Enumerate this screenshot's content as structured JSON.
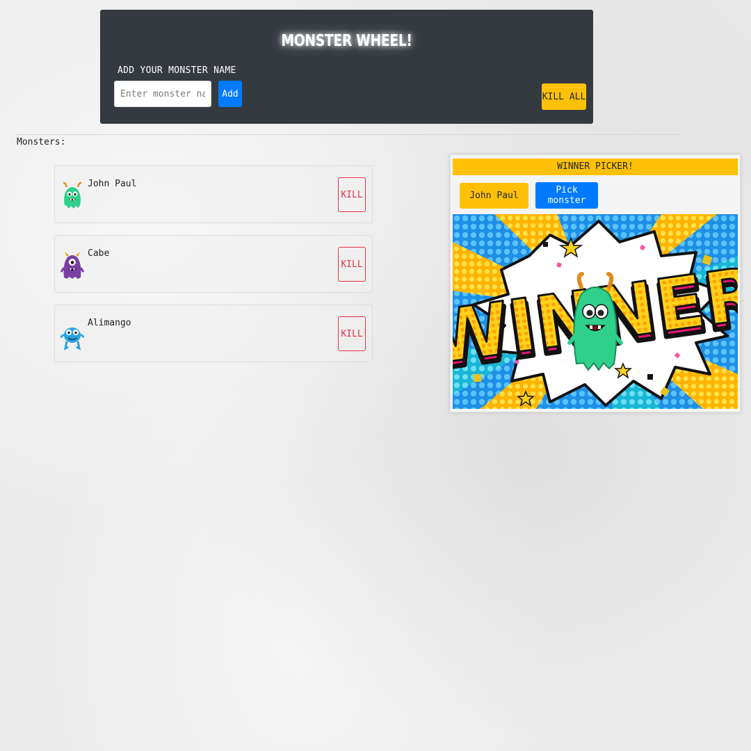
{
  "app": {
    "title": "MONSTER WHEEL!",
    "add_label": "ADD YOUR MONSTER NAME",
    "input_placeholder": "Enter monster name",
    "input_value": "",
    "add_button": "Add",
    "kill_all_button": "KILL ALL"
  },
  "list": {
    "title": "Monsters:",
    "monsters": [
      {
        "name": "John Paul",
        "kill_label": "KILL",
        "avatar": "green-monster-icon"
      },
      {
        "name": "Cabe",
        "kill_label": "KILL",
        "avatar": "purple-monster-icon"
      },
      {
        "name": "Alimango",
        "kill_label": "KILL",
        "avatar": "blue-monster-icon"
      }
    ]
  },
  "winner": {
    "header": "WINNER PICKER!",
    "selected": "John Paul",
    "pick_button": "Pick monster",
    "banner_text": "WINNER"
  },
  "colors": {
    "header_bg": "#343a40",
    "primary": "#007bff",
    "warning": "#ffc107",
    "danger": "#dc3545"
  }
}
